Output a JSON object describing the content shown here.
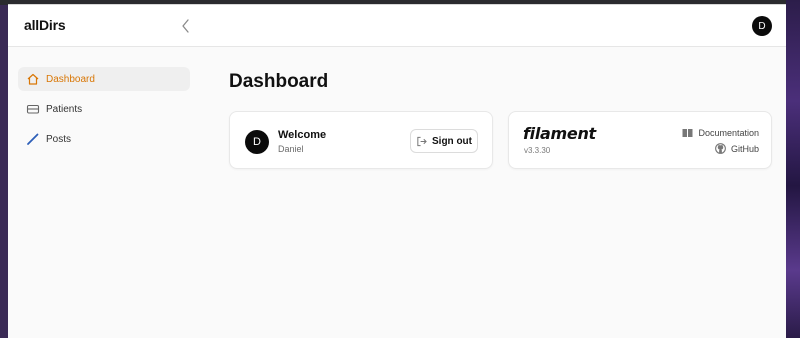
{
  "app": {
    "brand": "allDirs",
    "user_initial": "D"
  },
  "sidebar": {
    "items": [
      {
        "label": "Dashboard",
        "icon": "home-icon",
        "active": true
      },
      {
        "label": "Patients",
        "icon": "inbox-icon",
        "active": false
      },
      {
        "label": "Posts",
        "icon": "pencil-icon",
        "active": false
      }
    ]
  },
  "main": {
    "title": "Dashboard",
    "welcome_card": {
      "avatar_initial": "D",
      "heading": "Welcome",
      "user_name": "Daniel",
      "signout_label": "Sign out"
    },
    "filament_card": {
      "logo": "filament",
      "version": "v3.3.30",
      "docs_label": "Documentation",
      "github_label": "GitHub"
    }
  },
  "colors": {
    "accent": "#d97706",
    "avatar_bg": "#0b0b0b"
  }
}
